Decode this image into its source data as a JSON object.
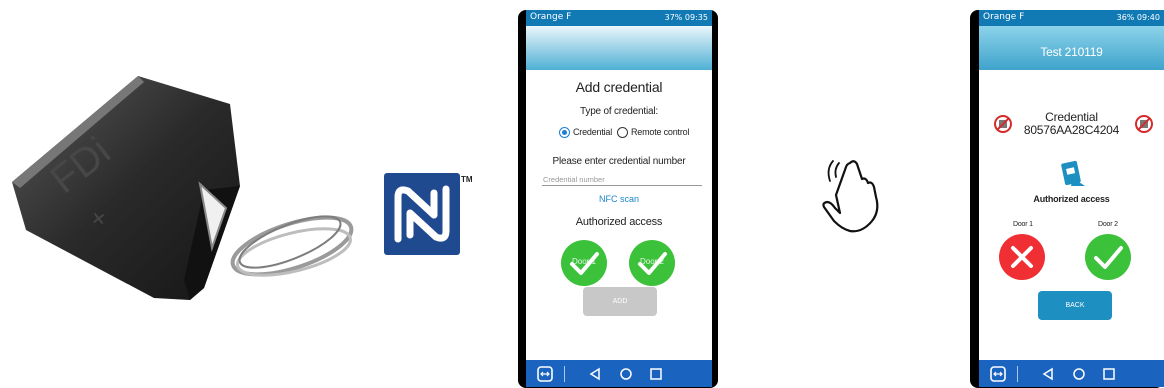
{
  "nfc": {
    "trademark": "TM"
  },
  "fob": {
    "engraving": "FDi"
  },
  "phone1": {
    "carrier": "Orange F",
    "status_right": "37% 09:35",
    "title": "Add credential",
    "type_label": "Type of credential:",
    "options": [
      "Credential",
      "Remote control"
    ],
    "selected_option": "Credential",
    "please_enter": "Please enter credential number",
    "input_placeholder": "Credential number",
    "nfc_scan": "NFC scan",
    "authorized": "Authorized access",
    "doors": [
      {
        "label": "Door 1",
        "authorized": true
      },
      {
        "label": "Door 2",
        "authorized": true
      }
    ],
    "add_button": "ADD"
  },
  "phone2": {
    "carrier": "Orange F",
    "status_right": "36% 09:40",
    "header_name": "Test 210119",
    "credential_label": "Credential",
    "credential_number": "80576AA28C4204",
    "authorized": "Authorized access",
    "doors": [
      {
        "label": "Door 1",
        "authorized": false
      },
      {
        "label": "Door 2",
        "authorized": true
      }
    ],
    "back_button": "BACK"
  },
  "colors": {
    "accent_blue": "#117ab5",
    "nav_blue": "#1a64c0",
    "success_green": "#3cc23a",
    "error_red": "#ef2f34",
    "nfc_blue": "#1f4a8f"
  },
  "icons": [
    "key-fob-image",
    "nfc-logo",
    "tap-hand-icon",
    "check-icon",
    "cross-icon",
    "no-entry-icon",
    "card-reader-icon",
    "back-nav-icon",
    "home-nav-icon",
    "recents-nav-icon"
  ]
}
